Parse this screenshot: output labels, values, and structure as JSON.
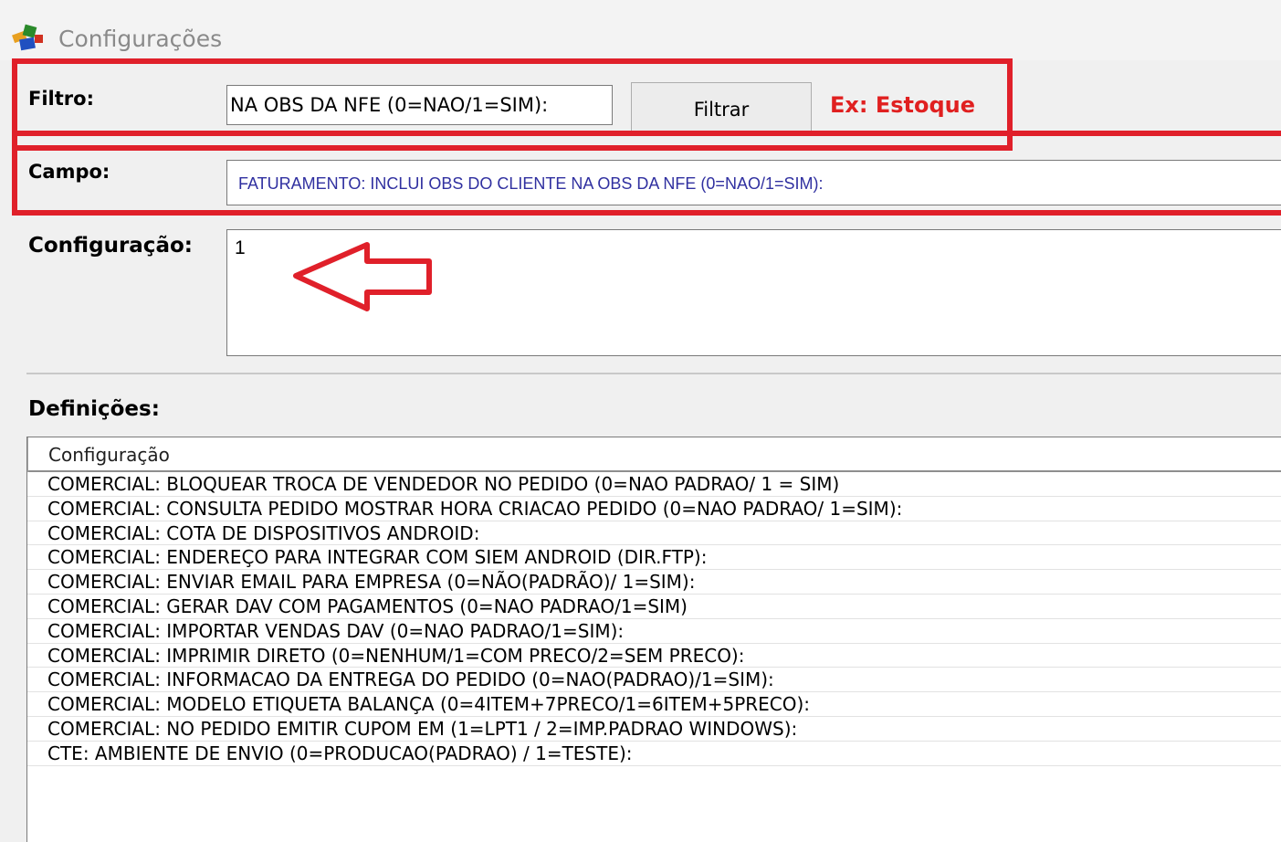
{
  "window": {
    "title": "Configurações"
  },
  "filter": {
    "label": "Filtro:",
    "value": "NA OBS DA NFE (0=NAO/1=SIM):",
    "button_label": "Filtrar",
    "example_hint": "Ex: Estoque"
  },
  "campo": {
    "label": "Campo:",
    "value": "FATURAMENTO: INCLUI OBS DO CLIENTE NA OBS DA NFE (0=NAO/1=SIM):"
  },
  "configuracao": {
    "label": "Configuração:",
    "value": "1"
  },
  "definicoes": {
    "label": "Definições:",
    "column_header": "Configuração",
    "rows": [
      "COMERCIAL: BLOQUEAR TROCA DE VENDEDOR NO PEDIDO (0=NAO PADRAO/ 1 = SIM)",
      "COMERCIAL: CONSULTA PEDIDO MOSTRAR HORA CRIACAO PEDIDO (0=NAO PADRAO/ 1=SIM):",
      "COMERCIAL: COTA DE DISPOSITIVOS ANDROID:",
      "COMERCIAL: ENDEREÇO PARA INTEGRAR COM SIEM ANDROID (DIR.FTP):",
      "COMERCIAL: ENVIAR EMAIL PARA EMPRESA (0=NÃO(PADRÃO)/ 1=SIM):",
      "COMERCIAL: GERAR DAV COM PAGAMENTOS (0=NAO PADRAO/1=SIM)",
      "COMERCIAL: IMPORTAR VENDAS DAV (0=NAO PADRAO/1=SIM):",
      "COMERCIAL: IMPRIMIR DIRETO (0=NENHUM/1=COM PRECO/2=SEM PRECO):",
      "COMERCIAL: INFORMACAO DA ENTREGA DO PEDIDO (0=NAO(PADRAO)/1=SIM):",
      "COMERCIAL: MODELO ETIQUETA BALANÇA (0=4ITEM+7PRECO/1=6ITEM+5PRECO):",
      "COMERCIAL: NO PEDIDO EMITIR CUPOM EM (1=LPT1 / 2=IMP.PADRAO WINDOWS):",
      "CTE: AMBIENTE DE ENVIO (0=PRODUCAO(PADRAO) / 1=TESTE):"
    ]
  },
  "colors": {
    "highlight": "#e0202a",
    "hint_text": "#e02020",
    "campo_text": "#3030a0"
  },
  "icons": {
    "title_icon": "app-logo-icon",
    "annotation": "left-arrow-annotation-icon"
  }
}
